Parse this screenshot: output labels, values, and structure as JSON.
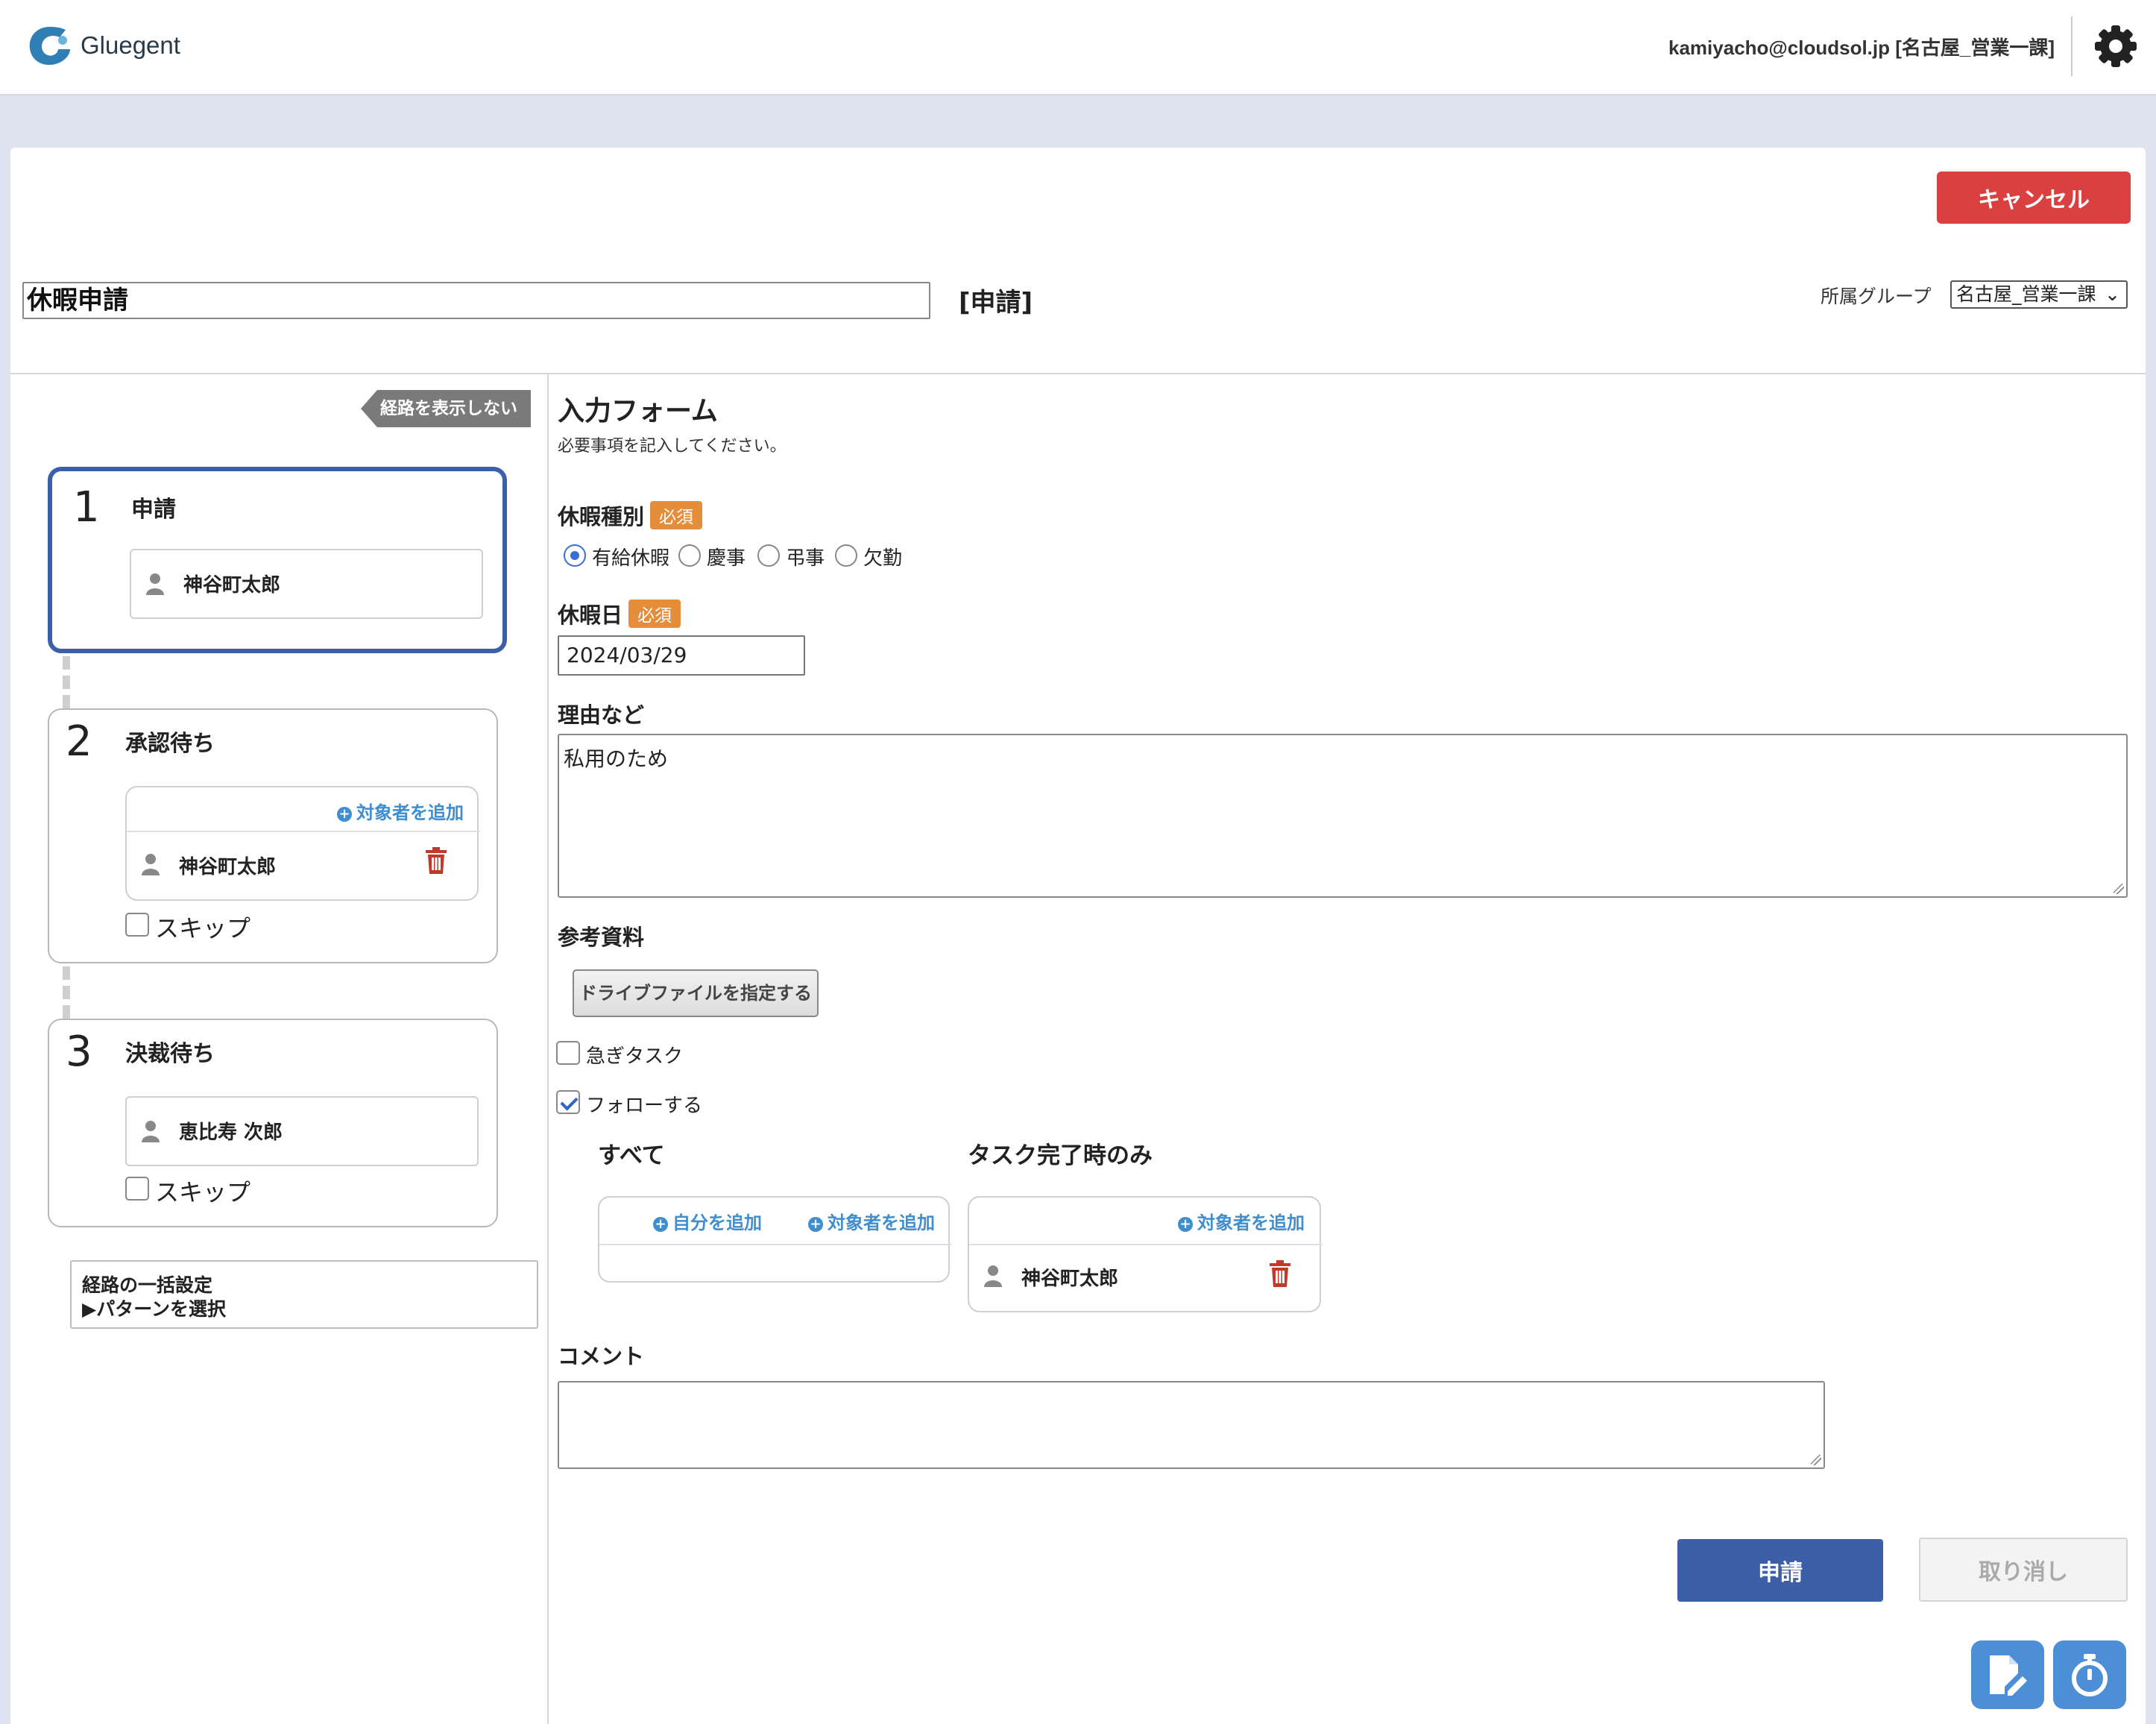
{
  "header": {
    "logo_text": "Gluegent",
    "user_info": "kamiyacho@cloudsol.jp [名古屋_営業一課]",
    "logo_icon": "gluegent-logo",
    "settings_icon": "gear-icon"
  },
  "toolbar": {
    "cancel_label": "キャンセル"
  },
  "title": {
    "value": "休暇申請",
    "mode": "[申請]"
  },
  "group": {
    "label": "所属グループ",
    "selected": "名古屋_営業一課"
  },
  "route": {
    "toggle_label": "経路を表示しない",
    "steps": [
      {
        "number": "1",
        "title": "申請",
        "users": [
          "神谷町太郎"
        ]
      },
      {
        "number": "2",
        "title": "承認待ち",
        "add_label": "対象者を追加",
        "users": [
          "神谷町太郎"
        ],
        "skip_label": "スキップ"
      },
      {
        "number": "3",
        "title": "決裁待ち",
        "users": [
          "恵比寿 次郎"
        ],
        "skip_label": "スキップ"
      }
    ],
    "pattern_title": "経路の一括設定",
    "pattern_link": "▶パターンを選択"
  },
  "form": {
    "title": "入力フォーム",
    "description": "必要事項を記入してください。",
    "required_badge": "必須",
    "leave_type": {
      "label": "休暇種別",
      "options": [
        "有給休暇",
        "慶事",
        "弔事",
        "欠勤"
      ],
      "selected": "有給休暇"
    },
    "leave_date": {
      "label": "休暇日",
      "value": "2024/03/29"
    },
    "reason": {
      "label": "理由など",
      "value": "私用のため"
    },
    "attachments": {
      "label": "参考資料",
      "button": "ドライブファイルを指定する"
    },
    "urgent": {
      "label": "急ぎタスク",
      "checked": false
    },
    "follow": {
      "label": "フォローする",
      "checked": true
    },
    "follow_all": {
      "title": "すべて",
      "add_self": "自分を追加",
      "add_target": "対象者を追加"
    },
    "follow_complete": {
      "title": "タスク完了時のみ",
      "add_target": "対象者を追加",
      "users": [
        "神谷町太郎"
      ]
    },
    "comment": {
      "label": "コメント",
      "value": ""
    }
  },
  "actions": {
    "submit": "申請",
    "withdraw": "取り消し"
  },
  "colors": {
    "cancel": "#d9403f",
    "submit": "#3c5fa7",
    "active_step": "#3b5fa8",
    "required_badge": "#e48d3a",
    "link": "#3e8ed0",
    "trash": "#c0392b",
    "fab": "#4d8fd6"
  }
}
